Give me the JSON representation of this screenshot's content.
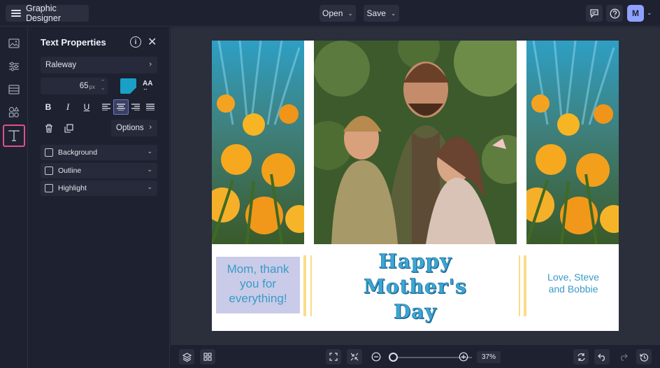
{
  "header": {
    "app_name": "Graphic Designer",
    "open_label": "Open",
    "save_label": "Save",
    "avatar_initial": "M"
  },
  "left_rail": {
    "items": [
      "image-icon",
      "adjust-icon",
      "layout-icon",
      "elements-icon",
      "text-icon"
    ],
    "active": "text-icon"
  },
  "text_properties": {
    "title": "Text Properties",
    "font": "Raleway",
    "font_size": "65",
    "font_size_unit": "px",
    "color": "#1aa0c6",
    "aa_label": "AA",
    "options_label": "Options",
    "toggles": [
      {
        "label": "Background",
        "checked": false
      },
      {
        "label": "Outline",
        "checked": false
      },
      {
        "label": "Highlight",
        "checked": false
      }
    ]
  },
  "card": {
    "left_text": "Mom, thank you for everything!",
    "center_line1": "Happy",
    "center_line2": "Mother's",
    "center_line3": "Day",
    "right_line1": "Love, Steve",
    "right_line2": "and Bobbie"
  },
  "bottom": {
    "zoom": "37%"
  },
  "colors": {
    "accent": "#8fa2ff",
    "text_blue": "#3a9bc9",
    "highlight_bar": "#f8dd88",
    "rail_active": "#e0508a"
  }
}
